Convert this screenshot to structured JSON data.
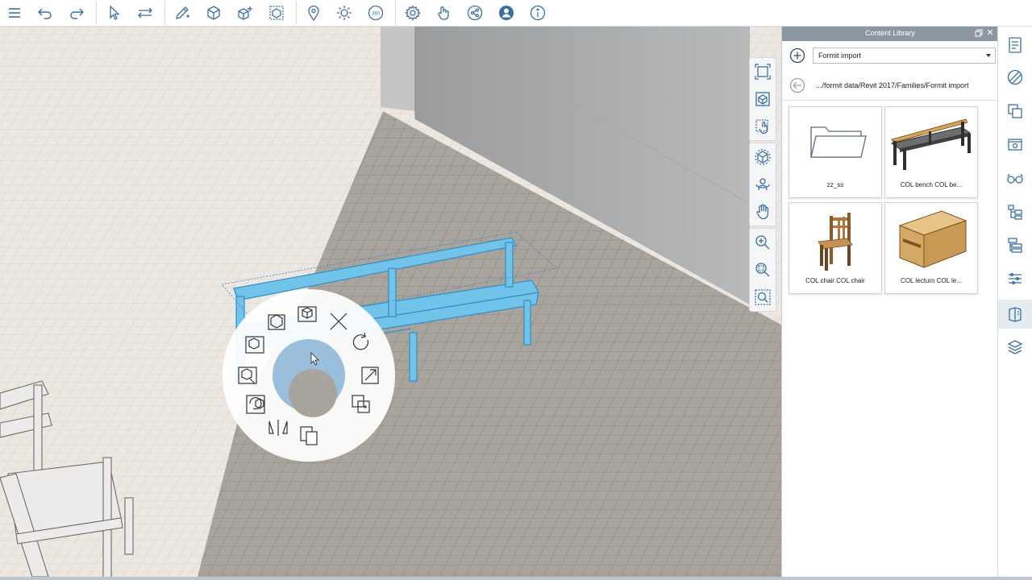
{
  "toolbar": {
    "buttons": [
      {
        "name": "menu-icon"
      },
      {
        "name": "undo-icon"
      },
      {
        "name": "redo-icon"
      },
      {
        "name": "select-arrow-icon"
      },
      {
        "name": "move-icon"
      },
      {
        "name": "sketch-pencil-icon"
      },
      {
        "name": "cube-primitive-icon"
      },
      {
        "name": "add-object-icon"
      },
      {
        "name": "group-icon"
      },
      {
        "name": "location-pin-icon"
      },
      {
        "name": "sun-icon"
      },
      {
        "name": "scene-360-icon"
      },
      {
        "name": "settings-icon"
      },
      {
        "name": "touch-gesture-icon"
      },
      {
        "name": "share-icon"
      },
      {
        "name": "user-icon"
      },
      {
        "name": "info-icon"
      }
    ],
    "scene_360_label": "360"
  },
  "view_tools": {
    "items": [
      "zoom-extents-icon",
      "view-cube-icon",
      "touch-select-icon",
      "orbit-icon",
      "look-around-icon",
      "pan-hand-icon",
      "zoom-in-icon",
      "zoom-window-icon",
      "zoom-selection-icon"
    ]
  },
  "radial_menu": {
    "items": [
      "replace-object-icon",
      "object-cube-icon",
      "delete-icon",
      "rotate-icon",
      "scale-icon",
      "copy-array-icon",
      "paste-icon",
      "mirror-icon",
      "rotate-object-icon",
      "edit-object-icon",
      "select-all-object-icon"
    ]
  },
  "panel": {
    "title": "Content Library",
    "library_select": "Formit import",
    "path": ".../formit data/Revit 2017/Families/Formit import",
    "items": [
      {
        "label": "zz_ss",
        "thumbnail": "folder"
      },
      {
        "label": "COL bench COL be...",
        "thumbnail": "bench"
      },
      {
        "label": "COL chair COL chair",
        "thumbnail": "chair"
      },
      {
        "label": "COL lecturn COL le...",
        "thumbnail": "lectern"
      }
    ]
  },
  "right_bar": {
    "items": [
      "properties-icon",
      "materials-icon",
      "layers-icon",
      "scenes-icon",
      "visual-styles-icon",
      "groups-icon",
      "hierarchy-icon",
      "levels-icon",
      "content-library-icon",
      "dynamo-icon"
    ],
    "active": "content-library-icon"
  },
  "colors": {
    "accent": "#4a90c4",
    "selection": "#6fc0e8",
    "panel_header": "#8d97a3",
    "grid_floor": "#c9c2b8"
  }
}
